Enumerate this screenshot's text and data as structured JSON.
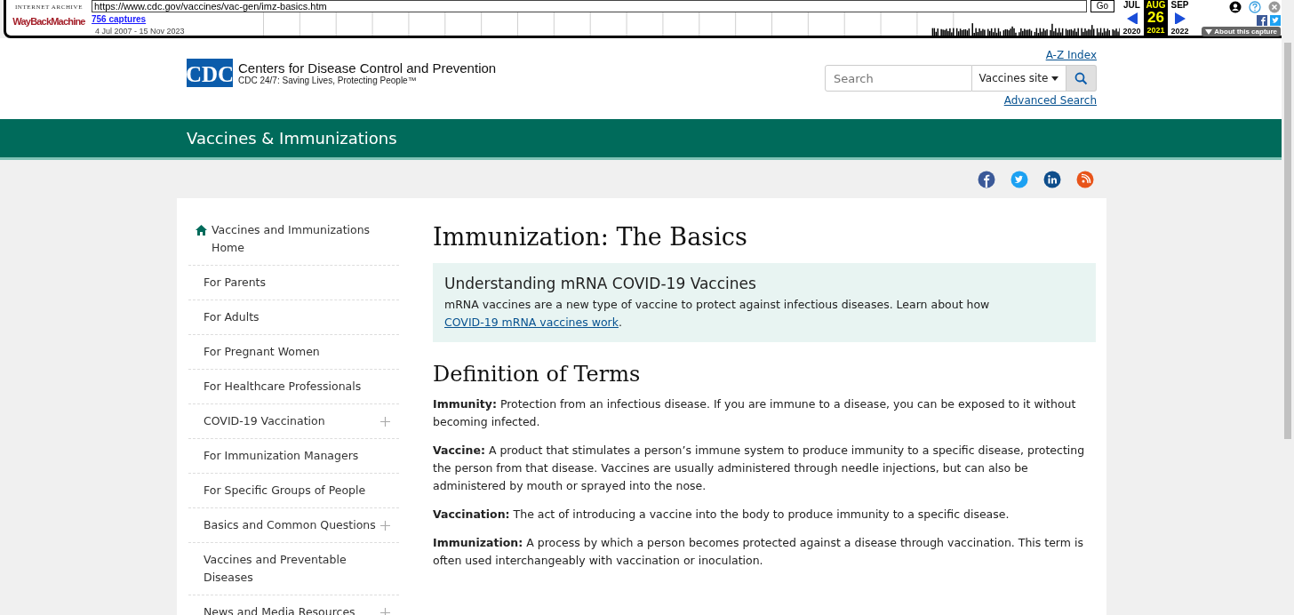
{
  "wayback": {
    "logo_top": "INTERNET ARCHIVE",
    "logo": "WayBackMachine",
    "url": "https://www.cdc.gov/vaccines/vac-gen/imz-basics.htm",
    "go": "Go",
    "captures": "756 captures",
    "range": "4 Jul 2007 - 15 Nov 2023",
    "months": [
      {
        "month": "JUL",
        "year": "2020",
        "selected": false
      },
      {
        "month": "AUG",
        "day": "26",
        "year": "2021",
        "selected": true
      },
      {
        "month": "SEP",
        "year": "2022",
        "selected": false
      }
    ],
    "about": "About this capture"
  },
  "header": {
    "logo": "CDC",
    "org": "Centers for Disease Control and Prevention",
    "tagline": "CDC 24/7: Saving Lives, Protecting People™",
    "az_index": "A-Z Index",
    "search": {
      "placeholder": "Search"
    },
    "scope": "Vaccines site",
    "advanced_search": "Advanced Search"
  },
  "banner": {
    "title": "Vaccines & Immunizations"
  },
  "sidebar": {
    "items": [
      {
        "label": "Vaccines and Immunizations Home",
        "kind": "home",
        "expandable": false
      },
      {
        "label": "For Parents",
        "kind": "link",
        "expandable": false
      },
      {
        "label": "For Adults",
        "kind": "link",
        "expandable": false
      },
      {
        "label": "For Pregnant Women",
        "kind": "link",
        "expandable": false
      },
      {
        "label": "For Healthcare Professionals",
        "kind": "link",
        "expandable": false
      },
      {
        "label": "COVID-19 Vaccination",
        "kind": "link",
        "expandable": true
      },
      {
        "label": "For Immunization Managers",
        "kind": "link",
        "expandable": false
      },
      {
        "label": "For Specific Groups of People",
        "kind": "link",
        "expandable": false
      },
      {
        "label": "Basics and Common Questions",
        "kind": "link",
        "expandable": true
      },
      {
        "label": "Vaccines and Preventable Diseases",
        "kind": "link",
        "expandable": false
      },
      {
        "label": "News and Media Resources",
        "kind": "link",
        "expandable": true
      }
    ]
  },
  "main": {
    "title": "Immunization: The Basics",
    "callout": {
      "title": "Understanding mRNA COVID-19 Vaccines",
      "text": "mRNA vaccines are a new type of vaccine to protect against infectious diseases. Learn about how",
      "link": "COVID-19 mRNA vaccines work",
      "after": "."
    },
    "section_title": "Definition of Terms",
    "definitions": [
      {
        "term": "Immunity:",
        "text": "Protection from an infectious disease. If you are immune to a disease, you can be exposed to it without becoming infected."
      },
      {
        "term": "Vaccine:",
        "text": "A product that stimulates a person’s immune system to produce immunity to a specific disease, protecting the person from that disease. Vaccines are usually administered through needle injections, but can also be administered by mouth or sprayed into the nose."
      },
      {
        "term": "Vaccination:",
        "text": "The act of introducing a vaccine into the body to produce immunity to a specific disease."
      },
      {
        "term": "Immunization:",
        "text": "A process by which a person becomes protected against a disease through vaccination. This term is often used interchangeably with vaccination or inoculation."
      }
    ]
  }
}
